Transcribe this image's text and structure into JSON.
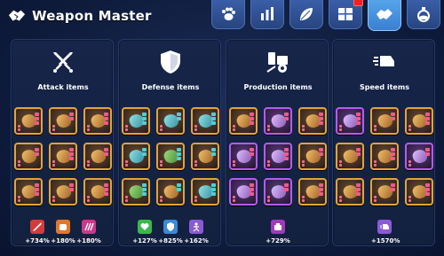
{
  "header": {
    "title": "Weapon Master",
    "tabs": [
      {
        "icon": "paw-icon",
        "active": false
      },
      {
        "icon": "bar-chart-icon",
        "active": false
      },
      {
        "icon": "leaf-icon",
        "active": false
      },
      {
        "icon": "gift-box-icon",
        "active": false,
        "badge": true
      },
      {
        "icon": "handshake-icon",
        "active": true
      },
      {
        "icon": "potion-icon",
        "active": false
      }
    ]
  },
  "panels": [
    {
      "title": "Attack items",
      "icon": "crossed-swords-icon",
      "bonuses": [
        {
          "icon": "sword-icon",
          "color": "#d63a3a",
          "value": "+734%"
        },
        {
          "icon": "fist-icon",
          "color": "#e0782a",
          "value": "+180%"
        },
        {
          "icon": "claw-icon",
          "color": "#c83a8a",
          "value": "+180%"
        }
      ]
    },
    {
      "title": "Defense items",
      "icon": "shield-icon",
      "bonuses": [
        {
          "icon": "heart-plus-icon",
          "color": "#3ab84a",
          "value": "+127%"
        },
        {
          "icon": "shield-small-icon",
          "color": "#3a8ad6",
          "value": "+825%"
        },
        {
          "icon": "figure-icon",
          "color": "#8a5ad6",
          "value": "+162%"
        }
      ]
    },
    {
      "title": "Production items",
      "icon": "production-icon",
      "bonuses": [
        {
          "icon": "coin-bag-icon",
          "color": "#a03ab8",
          "value": "+729%"
        }
      ]
    },
    {
      "title": "Speed items",
      "icon": "speed-icon",
      "bonuses": [
        {
          "icon": "speed-small-icon",
          "color": "#8a5ad6",
          "value": "+1570%"
        }
      ]
    }
  ]
}
